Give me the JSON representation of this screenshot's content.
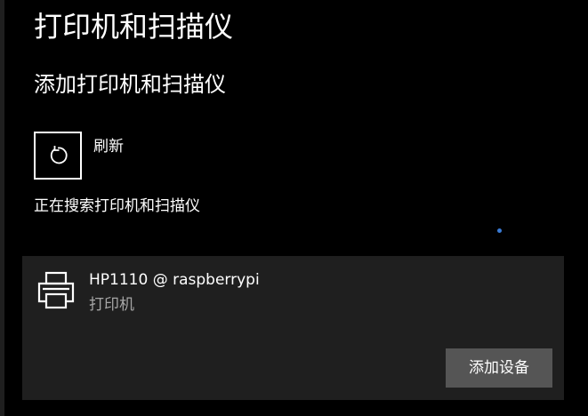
{
  "page": {
    "title": "打印机和扫描仪",
    "section_title": "添加打印机和扫描仪"
  },
  "refresh": {
    "label": "刷新",
    "icon": "refresh-icon"
  },
  "status": {
    "text": "正在搜索打印机和扫描仪",
    "progress_color": "#3a7bd5"
  },
  "device": {
    "name": "HP1110 @ raspberrypi",
    "type": "打印机",
    "icon": "printer-icon",
    "add_button_label": "添加设备"
  },
  "colors": {
    "background": "#000000",
    "card": "#1f1f1f",
    "button": "#555555",
    "secondary_text": "#a6a6a6"
  }
}
